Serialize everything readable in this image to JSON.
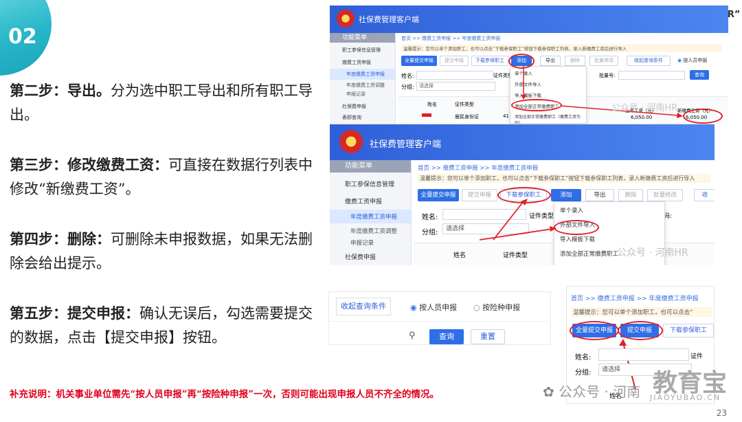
{
  "slide": {
    "number": "02",
    "page": "23",
    "steps": [
      {
        "label": "第二步：导出。",
        "text": "分为选中职工导出和所有职工导出。"
      },
      {
        "label": "第三步：修改缴费工资：",
        "text": "可直接在数据行列表中修改“新缴费工资”。"
      },
      {
        "label": "第四步：删除：",
        "text": "可删除未申报数据，如果无法删除会给出提示。"
      },
      {
        "label": "第五步：提交申报：",
        "text": "确认无误后，勾选需要提交的数据，点击【提交申报】按钮。"
      }
    ],
    "note": "补充说明：机关事业单位需先“按人员申报”再“按险种申报”一次，否则可能出现申报人员不齐全的情况。",
    "corner_text": "HR”"
  },
  "screenshot1": {
    "app_title": "社保费管理客户端",
    "menu_header": "功能菜单",
    "breadcrumb": "首页 >> 缴费工资申报 >> 年度缴费工资申报",
    "tip": "温馨提示：您可以单个添加职工，也可以点击“下载参保职工”按钮下载参保职工列表，录入新缴费工资后进行导入",
    "side_items": [
      "职工参保信息管理",
      "缴费工资申报",
      "年度缴费工资申报",
      "年度缴费工资调整",
      "申报记录",
      "社保费申报",
      "表即查询"
    ],
    "buttons": [
      "全量提交申报",
      "提交申报",
      "下载参保职工",
      "添加",
      "导出",
      "删除",
      "批量修改"
    ],
    "collapse": "收起查询条件",
    "by_person": "按人员申报",
    "search_btn": "查询",
    "name_label": "姓名:",
    "cert_label": "证件类型",
    "group_label": "分组:",
    "group_ph": "请选择",
    "col_name": "姓名",
    "col_cert": "证件类型",
    "cert_value": "居民身份证",
    "cert_prefix": "41",
    "dropdown": [
      "单个录入",
      "外部文件导入",
      "导入模板下载",
      "添加全部正常缴费职工",
      "添加全部正常缴费职工（缴费工资为空）"
    ],
    "col_wage_last": "上年工资（元）",
    "col_wage_new": "新缴费工资（元）",
    "wage_last": "6,050.00",
    "wage_new": "6,050.00",
    "batch_label": "批量号:"
  },
  "screenshot2": {
    "app_title": "社保费管理客户端",
    "menu_header": "功能菜单",
    "breadcrumb": "首页 >> 缴费工资申报 >> 年度缴费工资申报",
    "tip": "温馨提示：您可以单个添加职工，也可以点击“下载参保职工”按钮下载参保职工列表，录入新缴费工资后进行导入",
    "side_items": [
      "职工参保信息管理",
      "缴费工资申报",
      "年度缴费工资申报",
      "年度缴费工资调整",
      "申报记录",
      "社保费申报"
    ],
    "buttons": [
      "全量提交申报",
      "提交申报",
      "下载参保职工",
      "添加",
      "导出",
      "删除",
      "批量修改"
    ],
    "collapse_short": "收",
    "name_label": "姓名:",
    "cert_label": "证件类型",
    "group_label": "分组:",
    "group_ph": "请选择",
    "col_name": "姓名",
    "col_cert": "证件类型",
    "code_label": "码:",
    "dropdown": [
      "单个录入",
      "外部文件导入",
      "导入模板下载",
      "添加全部正常缴费职工"
    ]
  },
  "screenshot3": {
    "collapse": "收起查询条件",
    "by_person": "按人员申报",
    "by_insurance": "按险种申报",
    "search_btn": "查询",
    "reset_btn": "重置"
  },
  "screenshot4": {
    "breadcrumb": "首页 >> 缴费工资申报 >> 年度缴费工资申报",
    "tip": "温馨提示：您可以单个添加职工，也可以点击“",
    "btn_all": "全量提交申报",
    "btn_submit": "提交申报",
    "btn_download": "下载参保职工",
    "name_label": "姓名:",
    "cert_label": "证件",
    "group_label": "分组:",
    "group_ph": "请选择",
    "name_col": "姓名"
  },
  "watermarks": {
    "wm1": "公众号 · 河南HR",
    "wm2": "公众号 · 河南HR",
    "wm3": "公众号 · 河南",
    "brand": "教育宝",
    "brand_url": "JIAOYUBAO.CN"
  }
}
